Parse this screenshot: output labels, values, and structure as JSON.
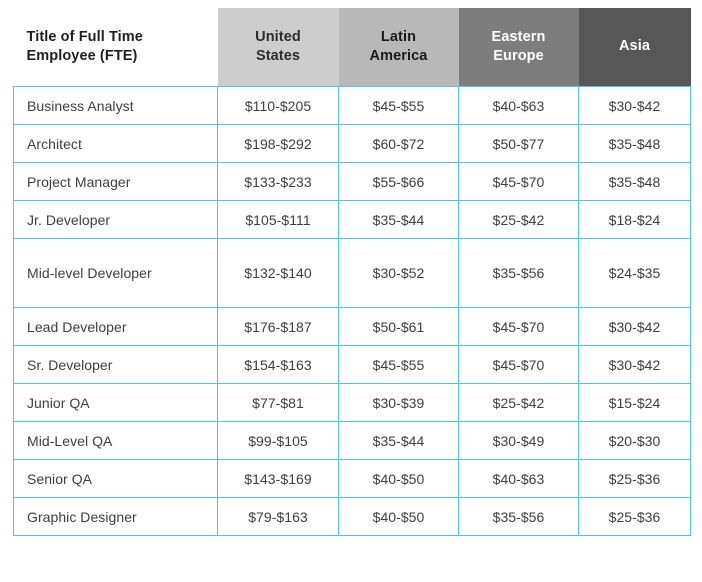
{
  "table": {
    "name": "fte-rate-table",
    "accent_border_color": "#4ec3ec",
    "headers": [
      {
        "key": "title",
        "label": "Title of Full Time\nEmployee (FTE)",
        "label_line1": "Title of Full Time",
        "label_line2": "Employee (FTE)",
        "bg": "#ffffff",
        "fg": "#231f20"
      },
      {
        "key": "united_states",
        "label_line1": "United",
        "label_line2": "States",
        "bg": "#cdcdcd",
        "fg": "#2d2d2d"
      },
      {
        "key": "latin_america",
        "label_line1": "Latin",
        "label_line2": "America",
        "bg": "#b8b8b8",
        "fg": "#1a1a1a"
      },
      {
        "key": "eastern_europe",
        "label_line1": "Eastern",
        "label_line2": "Europe",
        "bg": "#7d7d7d",
        "fg": "#ffffff"
      },
      {
        "key": "asia",
        "label_line1": "Asia",
        "label_line2": "",
        "bg": "#575757",
        "fg": "#ffffff"
      }
    ],
    "rows": [
      {
        "title": "Business Analyst",
        "united_states": "$110-$205",
        "latin_america": "$45-$55",
        "eastern_europe": "$40-$63",
        "asia": "$30-$42",
        "tall": false
      },
      {
        "title": "Architect",
        "united_states": "$198-$292",
        "latin_america": "$60-$72",
        "eastern_europe": "$50-$77",
        "asia": "$35-$48",
        "tall": false
      },
      {
        "title": "Project Manager",
        "united_states": "$133-$233",
        "latin_america": "$55-$66",
        "eastern_europe": "$45-$70",
        "asia": "$35-$48",
        "tall": false
      },
      {
        "title": "Jr. Developer",
        "united_states": "$105-$111",
        "latin_america": "$35-$44",
        "eastern_europe": "$25-$42",
        "asia": "$18-$24",
        "tall": false
      },
      {
        "title": "Mid-level Developer",
        "united_states": "$132-$140",
        "latin_america": "$30-$52",
        "eastern_europe": "$35-$56",
        "asia": "$24-$35",
        "tall": true
      },
      {
        "title": "Lead Developer",
        "united_states": "$176-$187",
        "latin_america": "$50-$61",
        "eastern_europe": "$45-$70",
        "asia": "$30-$42",
        "tall": false
      },
      {
        "title": "Sr. Developer",
        "united_states": "$154-$163",
        "latin_america": "$45-$55",
        "eastern_europe": "$45-$70",
        "asia": "$30-$42",
        "tall": false
      },
      {
        "title": "Junior QA",
        "united_states": "$77-$81",
        "latin_america": "$30-$39",
        "eastern_europe": "$25-$42",
        "asia": "$15-$24",
        "tall": false
      },
      {
        "title": "Mid-Level QA",
        "united_states": "$99-$105",
        "latin_america": "$35-$44",
        "eastern_europe": "$30-$49",
        "asia": "$20-$30",
        "tall": false
      },
      {
        "title": "Senior QA",
        "united_states": "$143-$169",
        "latin_america": "$40-$50",
        "eastern_europe": "$40-$63",
        "asia": "$25-$36",
        "tall": false
      },
      {
        "title": "Graphic Designer",
        "united_states": "$79-$163",
        "latin_america": "$40-$50",
        "eastern_europe": "$35-$56",
        "asia": "$25-$36",
        "tall": false
      }
    ]
  }
}
